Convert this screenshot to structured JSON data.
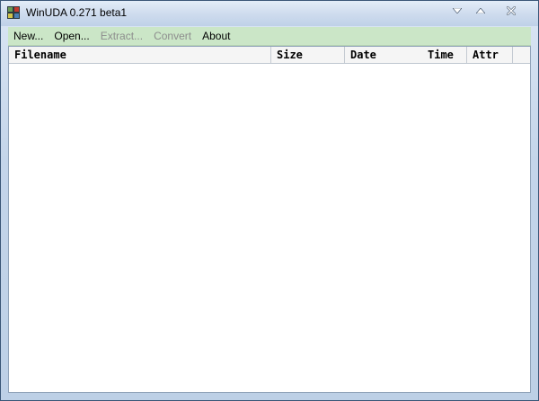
{
  "window": {
    "title": "WinUDA 0.271 beta1"
  },
  "titlebar": {
    "icons": [
      "app-icon",
      "dropdown-icon",
      "maximize-icon",
      "close-icon"
    ]
  },
  "menu": {
    "items": [
      {
        "label": "New...",
        "enabled": true
      },
      {
        "label": "Open...",
        "enabled": true
      },
      {
        "label": "Extract...",
        "enabled": false
      },
      {
        "label": "Convert",
        "enabled": false
      },
      {
        "label": "About",
        "enabled": true
      }
    ]
  },
  "list": {
    "columns": [
      {
        "label": "Filename"
      },
      {
        "label": "Size"
      },
      {
        "label": "Date"
      },
      {
        "label": "Time"
      },
      {
        "label": "Attr"
      }
    ],
    "rows": []
  },
  "colors": {
    "menubar_bg": "#cbe6c7",
    "disabled_text": "#8d8d8d",
    "frame": "#bdd0e6"
  }
}
